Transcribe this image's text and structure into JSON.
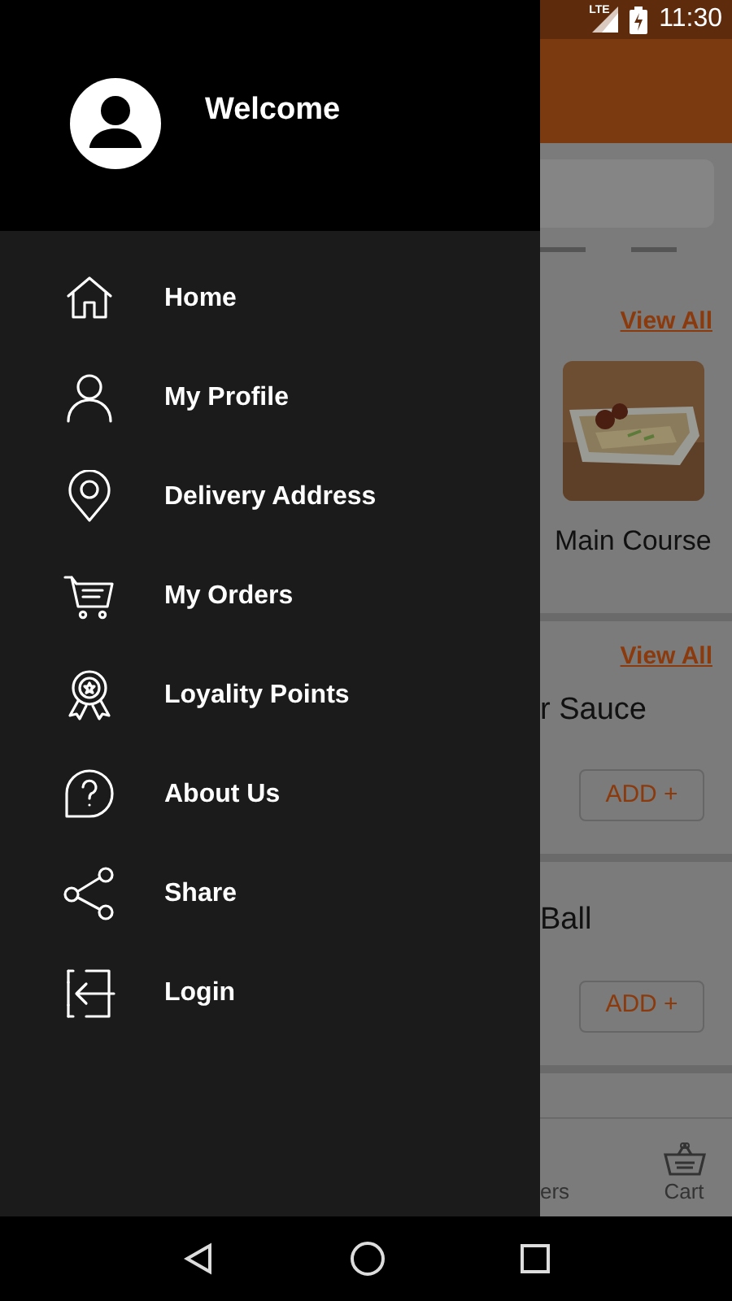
{
  "status_bar": {
    "network": "LTE",
    "time": "11:30"
  },
  "drawer": {
    "welcome": "Welcome",
    "items": [
      {
        "label": "Home",
        "kind": "home"
      },
      {
        "label": "My Profile",
        "kind": "person"
      },
      {
        "label": "Delivery Address",
        "kind": "pin"
      },
      {
        "label": "My Orders",
        "kind": "cart"
      },
      {
        "label": "Loyality Points",
        "kind": "badge"
      },
      {
        "label": "About Us",
        "kind": "question"
      },
      {
        "label": "Share",
        "kind": "share"
      },
      {
        "label": "Login",
        "kind": "login"
      }
    ]
  },
  "categories": {
    "link": "View All",
    "items": [
      {
        "label": "Main Course",
        "kind": "picture"
      }
    ]
  },
  "products": {
    "link": "View All",
    "items": [
      {
        "name": "r Sauce",
        "button": "ADD +"
      },
      {
        "name": "Ball",
        "button": "ADD +"
      }
    ]
  },
  "bottom_nav": [
    {
      "label": "ers",
      "kind": "plain"
    },
    {
      "label": "Cart",
      "kind": "basket"
    }
  ]
}
